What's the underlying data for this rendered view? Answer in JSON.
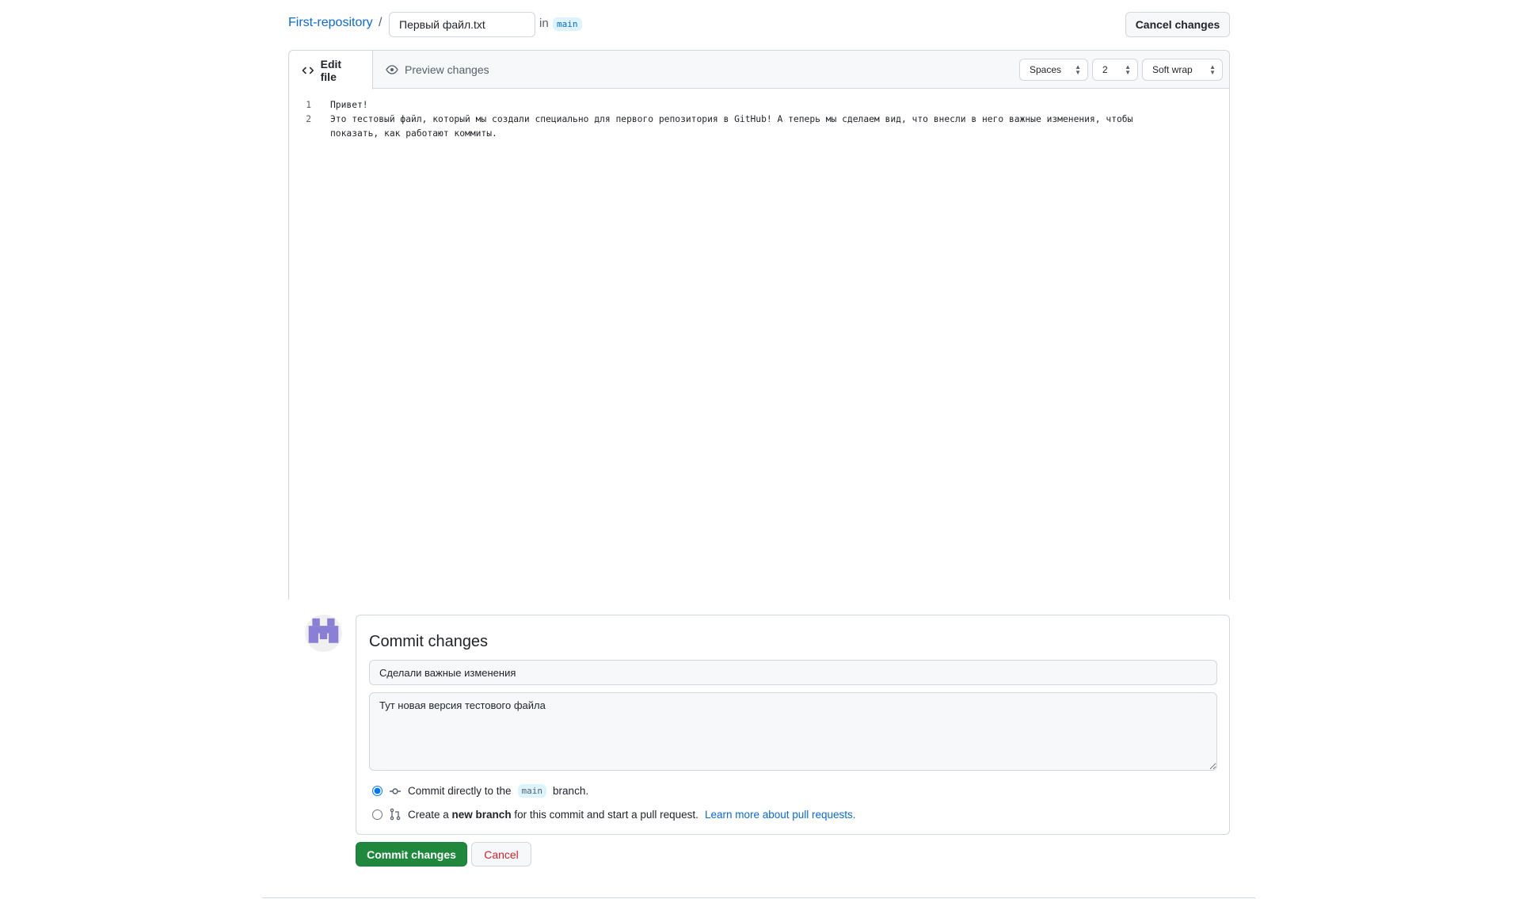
{
  "breadcrumb": {
    "repo": "First-repository",
    "separator": "/",
    "filename": "Первый файл.txt",
    "in_label": "in",
    "branch": "main"
  },
  "header": {
    "cancel_changes": "Cancel changes"
  },
  "editor": {
    "tabs": [
      {
        "label": "Edit file",
        "icon": "code-icon",
        "active": true
      },
      {
        "label": "Preview changes",
        "icon": "eye-icon",
        "active": false
      }
    ],
    "indent_mode": "Spaces",
    "indent_size": "2",
    "wrap_mode": "Soft wrap",
    "lines": [
      {
        "n": "1",
        "text": "Привет!"
      },
      {
        "n": "2",
        "text": "Это тестовый файл, который мы создали специально для первого репозитория в GitHub! А теперь мы сделаем вид, что внесли в него важные изменения, чтобы показать, как работают коммиты."
      }
    ]
  },
  "commit": {
    "title": "Commit changes",
    "summary": "Сделали важные изменения",
    "description": "Тут новая версия тестового файла",
    "option1": {
      "pre": "Commit directly to the",
      "branch": "main",
      "post": "branch.",
      "selected": true
    },
    "option2": {
      "pre": "Create a",
      "bold": "new branch",
      "post": "for this commit and start a pull request.",
      "link": "Learn more about pull requests.",
      "selected": false
    },
    "submit": "Commit changes",
    "cancel": "Cancel"
  },
  "colors": {
    "accent": "#0969da",
    "primary_button": "#1f883d",
    "danger": "#cf222e",
    "avatar": "#8a7fd6"
  }
}
